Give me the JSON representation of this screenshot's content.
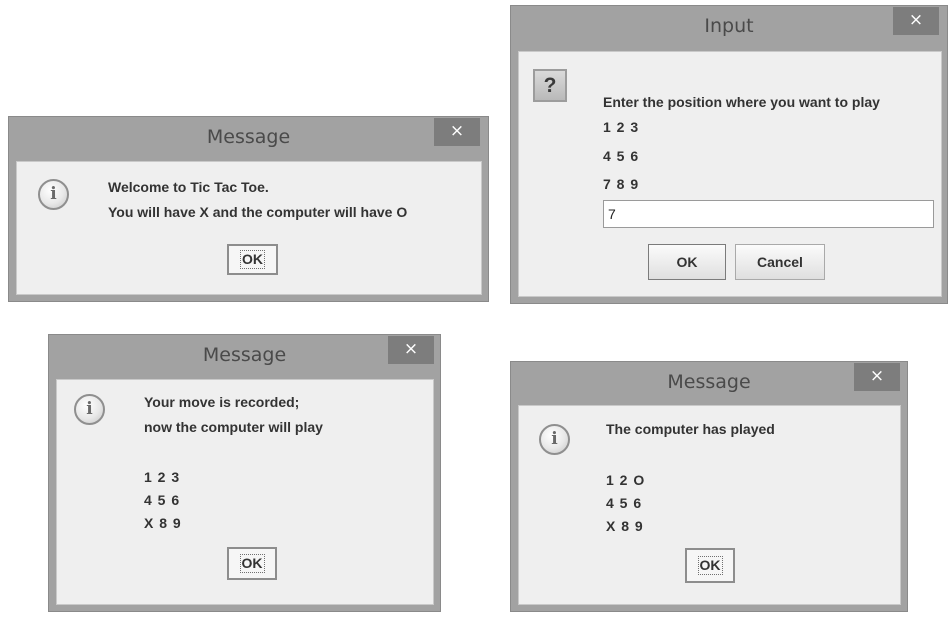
{
  "dialogs": {
    "welcome": {
      "title": "Message",
      "close": "×",
      "icon_glyph": "i",
      "lines": [
        "Welcome to Tic Tac Toe.",
        "You will have X and the computer will have O"
      ],
      "ok_label": "OK"
    },
    "input": {
      "title": "Input",
      "close": "×",
      "icon_glyph": "?",
      "prompt": "Enter the position where you want to play",
      "grid": [
        "1 2 3",
        "4 5 6",
        "7 8 9"
      ],
      "input_value": "7",
      "ok_label": "OK",
      "cancel_label": "Cancel"
    },
    "recorded": {
      "title": "Message",
      "close": "×",
      "icon_glyph": "i",
      "lines": [
        "Your move is recorded;",
        "now the computer will play"
      ],
      "grid": [
        "1 2 3",
        "4 5 6",
        "X 8 9"
      ],
      "ok_label": "OK"
    },
    "computer_played": {
      "title": "Message",
      "close": "×",
      "icon_glyph": "i",
      "lines": [
        "The computer has played"
      ],
      "grid": [
        "1 2 O",
        "4 5 6",
        "X 8 9"
      ],
      "ok_label": "OK"
    }
  },
  "colors": {
    "dialog_frame": "#a2a2a2",
    "content_bg": "#efefef",
    "close_button": "#7d7d7d",
    "text": "#333333"
  }
}
